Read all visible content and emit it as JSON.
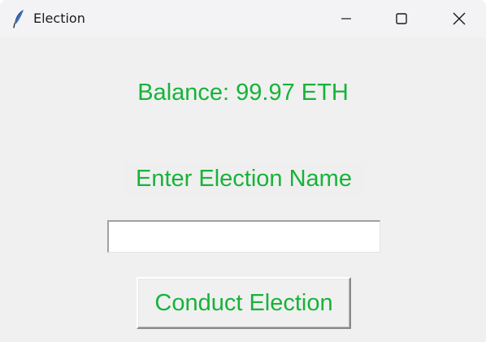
{
  "window": {
    "title": "Election",
    "icon": "feather-icon",
    "controls": [
      "minimize-icon",
      "maximize-icon",
      "close-icon"
    ]
  },
  "main": {
    "balance_label": "Balance: 99.97 ETH",
    "prompt_label": "Enter Election Name",
    "election_name": {
      "value": "",
      "placeholder": ""
    },
    "conduct_button_label": "Conduct Election"
  },
  "colors": {
    "accent_text": "#17b33a",
    "window_background": "#f0f0f0",
    "titlebar_background": "#f3f3f5"
  }
}
